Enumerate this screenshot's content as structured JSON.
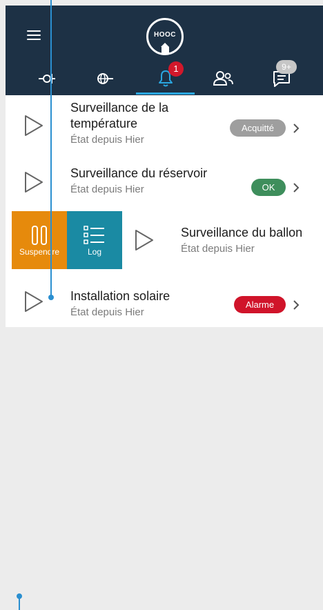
{
  "header": {
    "logo_text": "HOOC",
    "menu_icon": "hamburger-menu-icon",
    "tabs": [
      {
        "icon": "device-link-icon",
        "active": false
      },
      {
        "icon": "globe-link-icon",
        "active": false
      },
      {
        "icon": "bell-icon",
        "active": true,
        "badge": "1"
      },
      {
        "icon": "users-icon",
        "active": false
      },
      {
        "icon": "chat-icon",
        "active": false,
        "badge": "9+"
      }
    ],
    "colors": {
      "background": "#1d3145",
      "active_underline": "#2aa7e0",
      "badge_red": "#d2182b",
      "badge_grey": "#c6c6c6"
    }
  },
  "monitors": [
    {
      "title_line1": "Surveillance de la",
      "title_line2": "température",
      "subtitle": "État depuis Hier",
      "status": "Acquitté",
      "status_color": "#9e9e9e"
    },
    {
      "title": "Surveillance du réservoir",
      "subtitle": "État depuis Hier",
      "status": "OK",
      "status_color": "#3e8e5c"
    },
    {
      "title": "Surveillance du ballon",
      "subtitle": "État depuis Hier"
    },
    {
      "title": "Installation solaire",
      "subtitle": "État depuis Hier",
      "status": "Alarme",
      "status_color": "#d0142a"
    }
  ],
  "swipe_actions": {
    "suspend_label": "Suspendre",
    "suspend_color": "#e68a0c",
    "log_label": "Log",
    "log_color": "#1a8aa3"
  }
}
